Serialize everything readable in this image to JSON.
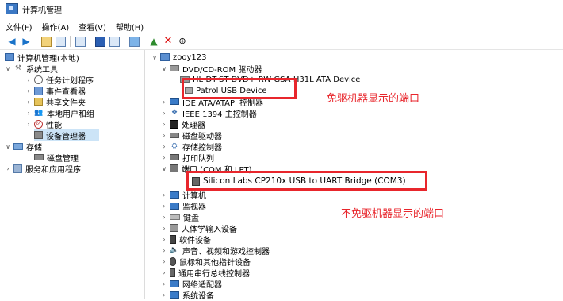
{
  "window": {
    "title": "计算机管理"
  },
  "menu": [
    "文件(F)",
    "操作(A)",
    "查看(V)",
    "帮助(H)"
  ],
  "toolbar_icons": [
    "back-arrow-icon",
    "forward-arrow-icon",
    "up-folder-icon",
    "console-tree-icon",
    "properties-icon",
    "help-icon",
    "view-icon",
    "monitor-icon",
    "update-driver-icon",
    "delete-icon",
    "download-icon"
  ],
  "left_tree": [
    {
      "label": "计算机管理(本地)",
      "icon": "computer-icon"
    },
    {
      "label": "系统工具",
      "icon": "tools-icon"
    },
    {
      "label": "任务计划程序",
      "icon": "clock-icon"
    },
    {
      "label": "事件查看器",
      "icon": "event-icon"
    },
    {
      "label": "共享文件夹",
      "icon": "share-icon"
    },
    {
      "label": "本地用户和组",
      "icon": "users-icon"
    },
    {
      "label": "性能",
      "icon": "perf-icon"
    },
    {
      "label": "设备管理器",
      "icon": "devmgr-icon"
    },
    {
      "label": "存储",
      "icon": "storage-icon"
    },
    {
      "label": "磁盘管理",
      "icon": "disk-icon"
    },
    {
      "label": "服务和应用程序",
      "icon": "services-icon"
    }
  ],
  "right_tree": [
    {
      "label": "zooy123"
    },
    {
      "label": "DVD/CD-ROM 驱动器"
    },
    {
      "label": "HL-DT-ST DVD+-RW GSA-H31L ATA Device"
    },
    {
      "label": "Patrol USB Device"
    },
    {
      "label": "IDE ATA/ATAPI 控制器"
    },
    {
      "label": "IEEE 1394 主控制器"
    },
    {
      "label": "处理器"
    },
    {
      "label": "磁盘驱动器"
    },
    {
      "label": "存储控制器"
    },
    {
      "label": "打印队列"
    },
    {
      "label": "端口 (COM 和 LPT)"
    },
    {
      "label": "Silicon Labs CP210x USB to UART Bridge (COM3)"
    },
    {
      "label": "计算机"
    },
    {
      "label": "监视器"
    },
    {
      "label": "键盘"
    },
    {
      "label": "人体学输入设备"
    },
    {
      "label": "软件设备"
    },
    {
      "label": "声音、视频和游戏控制器"
    },
    {
      "label": "鼠标和其他指针设备"
    },
    {
      "label": "通用串行总线控制器"
    },
    {
      "label": "网络适配器"
    },
    {
      "label": "系统设备"
    }
  ],
  "annotations": {
    "driverless": "免驱机器显示的端口",
    "non_driverless": "不免驱机器显示的端口"
  },
  "colors": {
    "highlight_red": "#e8262c",
    "selection": "#cce4f7"
  }
}
